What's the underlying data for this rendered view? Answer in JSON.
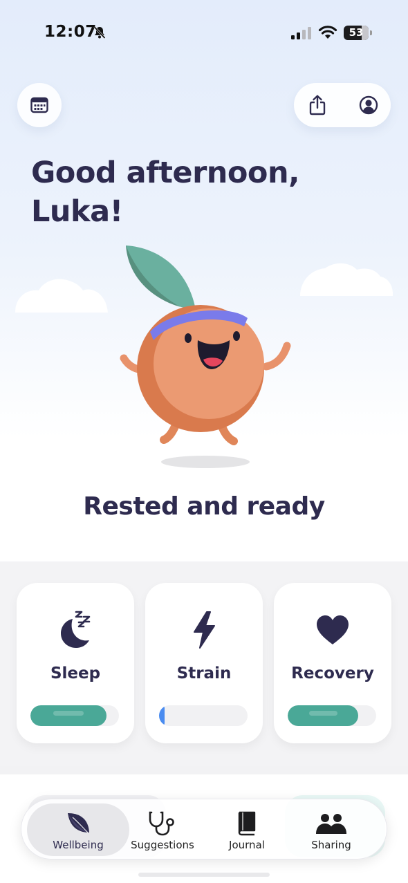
{
  "status_bar": {
    "time": "12:07",
    "battery": "53",
    "icons": [
      "bell-slash-icon",
      "signal-icon",
      "wifi-icon",
      "battery-icon"
    ]
  },
  "header": {
    "calendar_icon": "calendar-icon",
    "share_icon": "share-icon",
    "profile_icon": "profile-icon"
  },
  "greeting": "Good afternoon,\nLuka!",
  "mood": "Rested and ready",
  "metrics": [
    {
      "label": "Sleep",
      "icon": "moon-zzz-icon",
      "level": 0.86,
      "color": "#4aa897"
    },
    {
      "label": "Strain",
      "icon": "lightning-icon",
      "level": 0.05,
      "color": "#4a8cf0"
    },
    {
      "label": "Recovery",
      "icon": "heart-icon",
      "level": 0.8,
      "color": "#4aa897"
    }
  ],
  "tabbar": {
    "tabs": [
      {
        "label": "Wellbeing",
        "icon": "leaf-icon",
        "active": true
      },
      {
        "label": "Suggestions",
        "icon": "stethoscope-icon",
        "active": false
      },
      {
        "label": "Journal",
        "icon": "book-icon",
        "active": false
      },
      {
        "label": "Sharing",
        "icon": "people-icon",
        "active": false
      }
    ]
  },
  "colors": {
    "text_dark": "#2e2b4f",
    "accent_green": "#4aa897",
    "accent_blue": "#4a8cf0",
    "mascot_orange": "#eb9a72"
  }
}
